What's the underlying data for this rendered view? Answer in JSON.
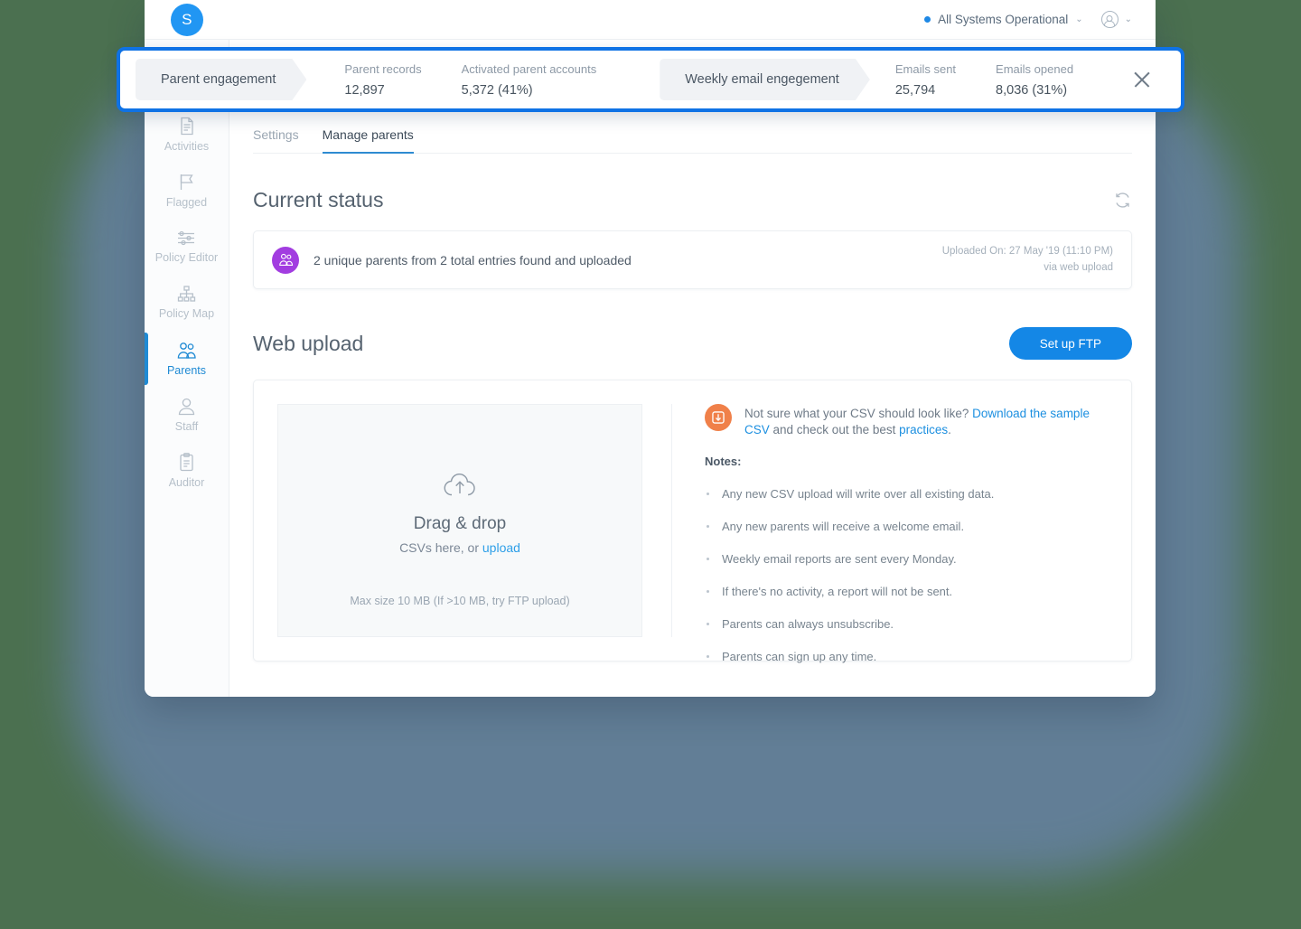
{
  "app": {
    "logo_letter": "S"
  },
  "topbar": {
    "status_text": "All Systems Operational",
    "status_color": "#1e88e5",
    "caret": "⌄"
  },
  "sidebar": {
    "items": [
      {
        "label": "Activities",
        "icon": "document-icon",
        "active": false
      },
      {
        "label": "Flagged",
        "icon": "flag-icon",
        "active": false
      },
      {
        "label": "Policy Editor",
        "icon": "sliders-icon",
        "active": false
      },
      {
        "label": "Policy Map",
        "icon": "sitemap-icon",
        "active": false
      },
      {
        "label": "Parents",
        "icon": "parents-icon",
        "active": true
      },
      {
        "label": "Staff",
        "icon": "person-icon",
        "active": false
      },
      {
        "label": "Auditor",
        "icon": "clipboard-icon",
        "active": false
      }
    ],
    "active_color": "#1f8ad4"
  },
  "highlight_bar": {
    "border_color": "#0f72e5",
    "groups": [
      {
        "chip": "Parent engagement",
        "metrics": [
          {
            "label": "Parent records",
            "value": "12,897"
          },
          {
            "label": "Activated parent accounts",
            "value": "5,372 (41%)"
          }
        ]
      },
      {
        "chip": "Weekly email engegement",
        "metrics": [
          {
            "label": "Emails sent",
            "value": "25,794"
          },
          {
            "label": "Emails opened",
            "value": "8,036 (31%)"
          }
        ]
      }
    ],
    "close_label": "close-icon"
  },
  "tabs": [
    {
      "label": "Settings",
      "active": false
    },
    {
      "label": "Manage parents",
      "active": true
    }
  ],
  "current_status": {
    "title": "Current status",
    "refresh_icon": "refresh-icon",
    "message": "2 unique parents from 2 total entries found and uploaded",
    "uploaded_on": "Uploaded On: 27 May '19 (11:10 PM)",
    "via": "via web upload",
    "icon_color": "#a23de0"
  },
  "web_upload": {
    "title": "Web upload",
    "ftp_button": "Set up FTP",
    "ftp_button_color": "#1487e6",
    "dropzone": {
      "title": "Drag & drop",
      "subtitle_prefix": "CSVs here, or ",
      "subtitle_link": "upload",
      "max_size": "Max size 10 MB (If >10 MB, try FTP upload)"
    },
    "notes": {
      "intro_prefix": "Not sure what your CSV should look like? ",
      "intro_link1": "Download the sample CSV",
      "intro_middle": " and check out the best ",
      "intro_link2": "practices",
      "intro_suffix": ".",
      "label": "Notes:",
      "items": [
        "Any new CSV upload will write over all existing data.",
        "Any new parents will receive a welcome email.",
        "Weekly email reports are sent every Monday.",
        "If there's no activity, a report will not be sent.",
        "Parents can always unsubscribe.",
        "Parents can sign up any time."
      ]
    }
  }
}
